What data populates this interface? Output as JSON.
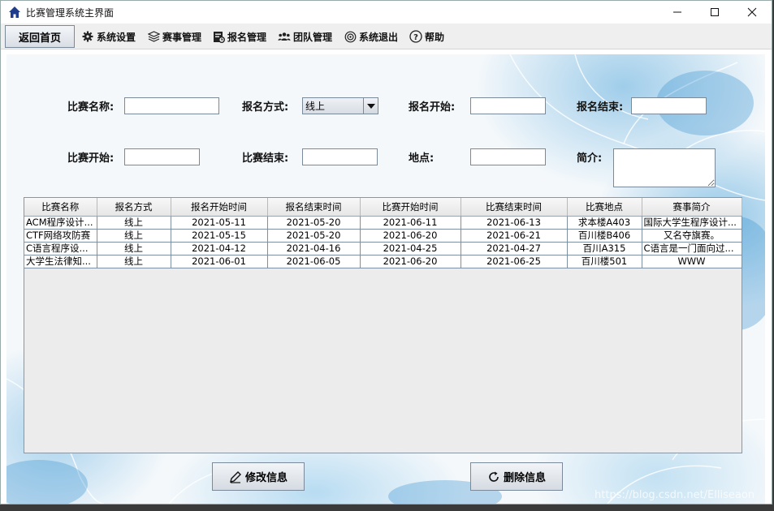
{
  "window": {
    "title": "比赛管理系统主界面"
  },
  "menubar": {
    "home_label": "返回首页",
    "items": [
      {
        "label": "系统设置",
        "icon": "gear-icon"
      },
      {
        "label": "赛事管理",
        "icon": "layers-icon"
      },
      {
        "label": "报名管理",
        "icon": "registration-icon"
      },
      {
        "label": "团队管理",
        "icon": "team-icon"
      },
      {
        "label": "系统退出",
        "icon": "exit-icon"
      },
      {
        "label": "帮助",
        "icon": "help-icon"
      }
    ]
  },
  "form": {
    "name_label": "比赛名称:",
    "name_value": "",
    "method_label": "报名方式:",
    "method_value": "线上",
    "reg_start_label": "报名开始:",
    "reg_start_value": "",
    "reg_end_label": "报名结束:",
    "reg_end_value": "",
    "comp_start_label": "比赛开始:",
    "comp_start_value": "",
    "comp_end_label": "比赛结束:",
    "comp_end_value": "",
    "location_label": "地点:",
    "location_value": "",
    "intro_label": "简介:",
    "intro_value": ""
  },
  "table": {
    "columns": [
      "比赛名称",
      "报名方式",
      "报名开始时间",
      "报名结束时间",
      "比赛开始时间",
      "比赛结束时间",
      "比赛地点",
      "赛事简介"
    ],
    "rows": [
      [
        "ACM程序设计...",
        "线上",
        "2021-05-11",
        "2021-05-20",
        "2021-06-11",
        "2021-06-13",
        "求本楼A403",
        "国际大学生程序设计..."
      ],
      [
        "CTF网络攻防赛",
        "线上",
        "2021-05-15",
        "2021-05-20",
        "2021-06-20",
        "2021-06-21",
        "百川楼B406",
        "又名夺旗赛。"
      ],
      [
        "C语言程序设...",
        "线上",
        "2021-04-12",
        "2021-04-16",
        "2021-04-25",
        "2021-04-27",
        "百川A315",
        "C语言是一门面向过..."
      ],
      [
        "大学生法律知...",
        "线上",
        "2021-06-01",
        "2021-06-05",
        "2021-06-20",
        "2021-06-25",
        "百川楼501",
        "WWW"
      ]
    ]
  },
  "actions": {
    "edit_label": "修改信息",
    "delete_label": "删除信息"
  },
  "watermark": "https://blog.csdn.net/Elliseaon",
  "colors": {
    "title_icon": "#1f3d8a",
    "background_accent": "#5aaadc"
  }
}
